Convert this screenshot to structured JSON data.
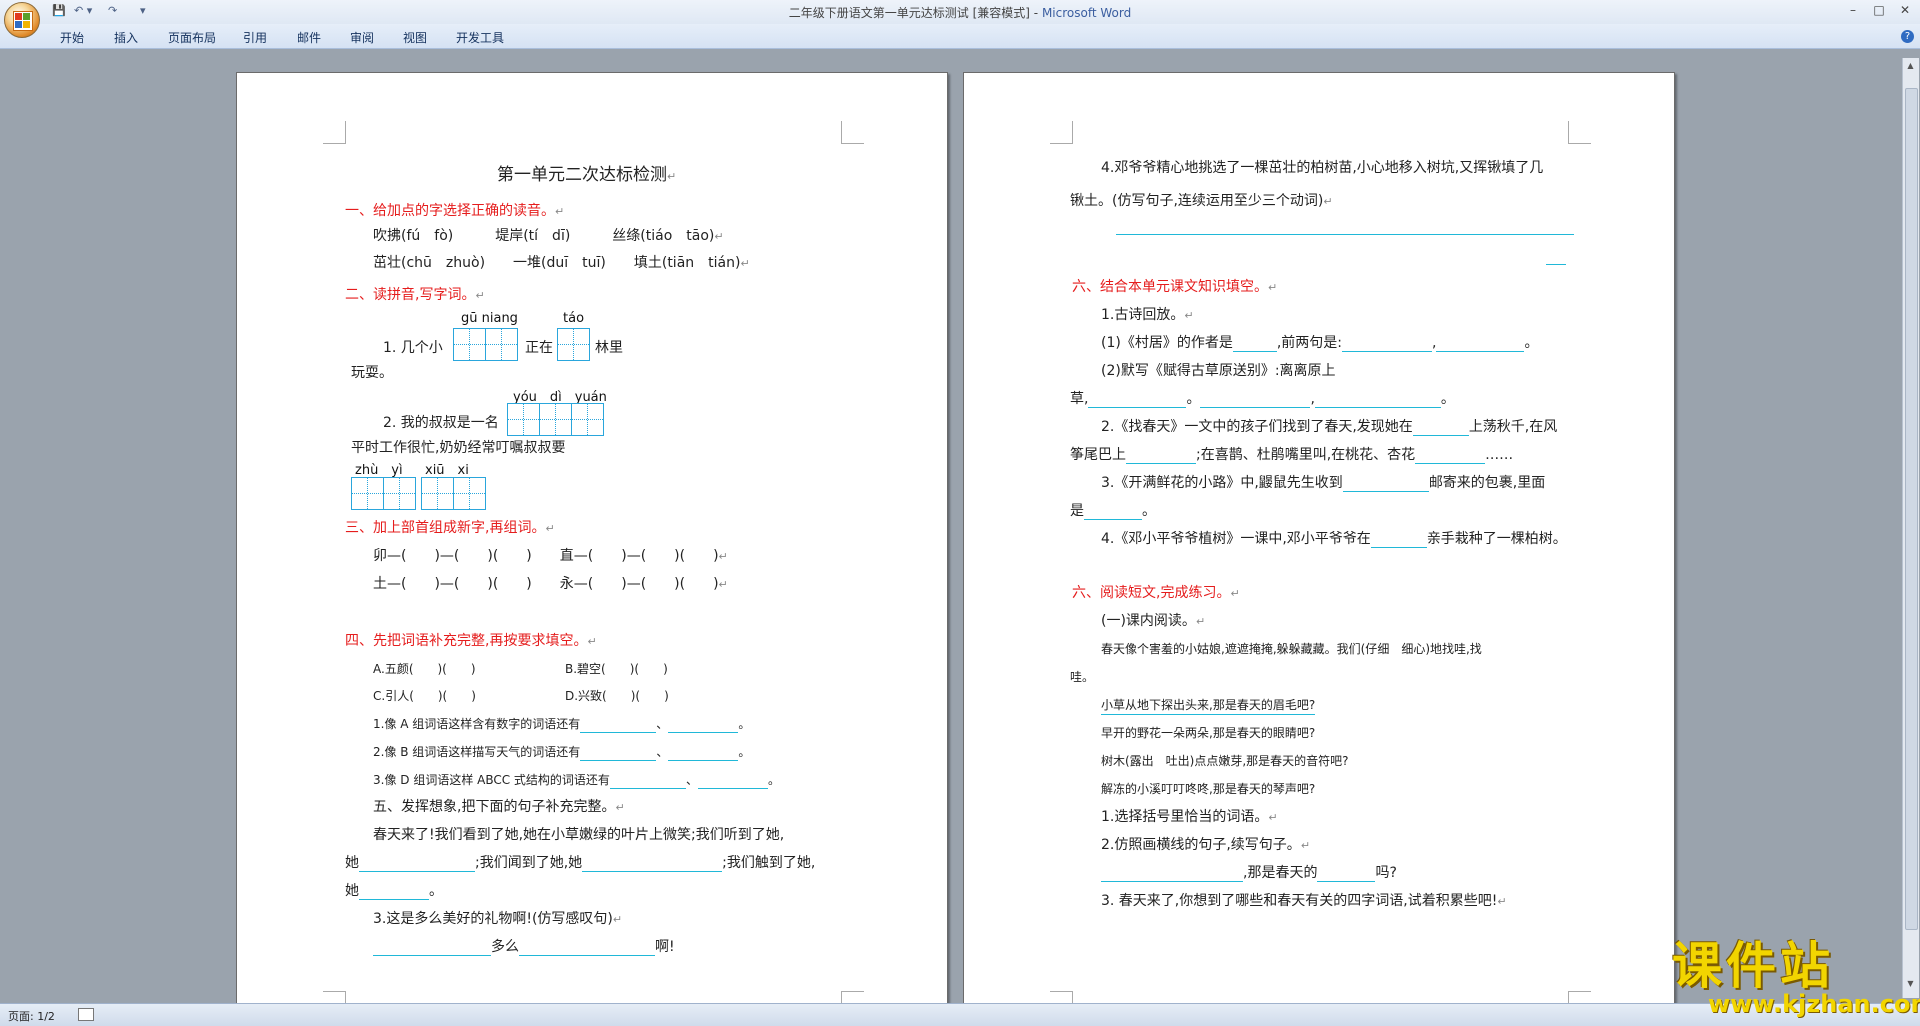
{
  "window": {
    "title_doc": "二年级下册语文第一单元达标测试 [兼容模式]",
    "title_sep": " - ",
    "title_app": "Microsoft Word",
    "min": "–",
    "max": "□",
    "close": "✕"
  },
  "qat": {
    "save": "💾",
    "undo": "↶ ▾",
    "redo": "↷",
    "more": "▾"
  },
  "ribbon": {
    "tabs": [
      "开始",
      "插入",
      "页面布局",
      "引用",
      "邮件",
      "审阅",
      "视图",
      "开发工具"
    ],
    "help": "?"
  },
  "status": {
    "page": "页面: 1/2"
  },
  "watermark": {
    "text": "课件站",
    "url": "www.kjzhan.com"
  },
  "page1": {
    "title": "第一单元二次达标检测",
    "s1": "一、给加点的字选择正确的读音。",
    "s1a": "吹拂(fú　fò)　　　堤岸(tí　dī)　　　丝绦(tiáo　tāo)",
    "s1b": "茁壮(chū　zhuò)　　一堆(duī　tuī)　　填土(tiān　tián)",
    "s2": "二、读拼音,写字词。",
    "py1": "gū niang",
    "py2": "táo",
    "q1a": "1. 几个小",
    "q1b": "正在",
    "q1c": "林里",
    "q1d": "玩耍。",
    "py3": "yóu　dì　yuán",
    "q2a": "2. 我的叔叔是一名",
    "q2b": "平时工作很忙,奶奶经常叮嘱叔叔要",
    "py4": "zhù　yì",
    "py5": "xiū　xi",
    "s3": "三、加上部首组成新字,再组词。",
    "s3a": "卯—(　　)—(　　)(　　)　　直—(　　)—(　　)(　　)",
    "s3b": "土—(　　)—(　　)(　　)　　永—(　　)—(　　)(　　)",
    "s4": "四、先把词语补充完整,再按要求填空。",
    "s4a": "A.五颜(　　)(　　)",
    "s4b": "B.碧空(　　)(　　)",
    "s4c": "C.引人(　　)(　　)",
    "s4d": "D.兴致(　　)(　　)",
    "s4e": "1.像 A 组词语这样含有数字的词语还有",
    "s4f": "2.像 B 组词语这样描写天气的词语还有",
    "s4g": "3.像 D 组词语这样 ABCC 式结构的词语还有",
    "s5": "五、发挥想象,把下面的句子补充完整。",
    "s5a": "春天来了!我们看到了她,她在小草嫩绿的叶片上微笑;我们听到了她,",
    "s5b1": "她",
    "s5b2": ";我们闻到了她,她",
    "s5b3": ";我们触到了她,",
    "s5c": "她",
    "s5d": "3.这是多么美好的礼物啊!(仿写感叹句)",
    "s5e": "多么",
    "s5f": "啊!"
  },
  "page2": {
    "a1": "4.邓爷爷精心地挑选了一棵茁壮的柏树苗,小心地移入树坑,又挥锹填了几",
    "a2": "锹土。(仿写句子,连续运用至少三个动词)",
    "b": "六、结合本单元课文知识填空。",
    "b1": "1.古诗回放。",
    "b2a": "(1)《村居》的作者是",
    "b2b": ",前两句是:",
    "b3": "(2)默写《赋得古草原送别》:离离原上",
    "b4": "草,",
    "b5a": "2.《找春天》一文中的孩子们找到了春天,发现她在",
    "b5b": "上荡秋千,在风",
    "b6a": "筝尾巴上",
    "b6b": ";在喜鹊、杜鹃嘴里叫,在桃花、杏花",
    "b6c": "……",
    "b7a": "3.《开满鲜花的小路》中,鼹鼠先生收到",
    "b7b": "邮寄来的包裹,里面",
    "b8": "是",
    "b9a": "4.《邓小平爷爷植树》一课中,邓小平爷爷在",
    "b9b": "亲手栽种了一棵柏树。",
    "c": "六、阅读短文,完成练习。",
    "c1": "(一)课内阅读。",
    "c2": "春天像个害羞的小姑娘,遮遮掩掩,躲躲藏藏。我们(仔细　细心)地找哇,找",
    "c3": "哇。",
    "c4": "小草从地下探出头来,那是春天的眉毛吧?",
    "c5": "早开的野花一朵两朵,那是春天的眼睛吧?",
    "c6": "树木(露出　吐出)点点嫩芽,那是春天的音符吧?",
    "c7": "解冻的小溪叮叮咚咚,那是春天的琴声吧?",
    "c8": "1.选择括号里恰当的词语。",
    "c9": "2.仿照画横线的句子,续写句子。",
    "c10a": ",那是春天的",
    "c10b": "吗?",
    "c11": "3. 春天来了,你想到了哪些和春天有关的四字词语,试着积累些吧!"
  },
  "ret": "↵",
  "colors": {
    "accent_red": "#e51d1d",
    "underline": "#20b8d8",
    "watermark": "#f2d500"
  }
}
